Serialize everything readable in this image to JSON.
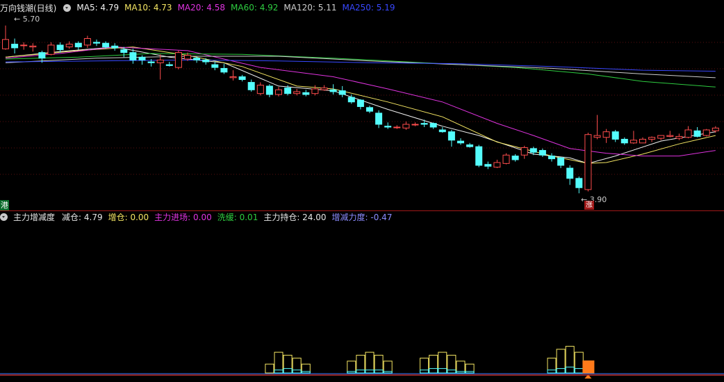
{
  "main_panel": {
    "title": "万向钱潮(日线)",
    "indicators": [
      {
        "label": "MA5: 4.79",
        "color": "#f2f2f2"
      },
      {
        "label": "MA10: 4.73",
        "color": "#f5e663"
      },
      {
        "label": "MA20: 4.58",
        "color": "#e033e0"
      },
      {
        "label": "MA60: 4.92",
        "color": "#2ecc40"
      },
      {
        "label": "MA120: 5.11",
        "color": "#cfcfcf"
      },
      {
        "label": "MA250: 5.19",
        "color": "#3848ff"
      }
    ],
    "high_label": "5.70",
    "low_label": "3.90",
    "mark_left": "港",
    "mark_low": "涨"
  },
  "sub_panel": {
    "title": "主力增减度",
    "indicators": [
      {
        "label": "减仓: 4.79",
        "color": "#e6e6e6"
      },
      {
        "label": "增仓: 0.00",
        "color": "#f5e663"
      },
      {
        "label": "主力进场: 0.00",
        "color": "#e033e0"
      },
      {
        "label": "洗缓: 0.01",
        "color": "#2ecc40"
      },
      {
        "label": "主力持仓: 24.00",
        "color": "#e6e6e6"
      },
      {
        "label": "增减力度: -0.47",
        "color": "#8c8cff"
      }
    ]
  },
  "chart_data": {
    "type": "candlestick",
    "ylim": [
      3.85,
      5.75
    ],
    "up_color": "#ff4d4d",
    "down_color": "#54fcfc",
    "candles": [
      [
        5.45,
        5.55,
        5.7,
        5.44
      ],
      [
        5.5,
        5.46,
        5.56,
        5.4
      ],
      [
        5.49,
        5.49,
        5.52,
        5.44
      ],
      [
        5.47,
        5.48,
        5.51,
        5.42
      ],
      [
        5.41,
        5.35,
        5.43,
        5.3
      ],
      [
        5.39,
        5.49,
        5.52,
        5.38
      ],
      [
        5.49,
        5.44,
        5.52,
        5.41
      ],
      [
        5.47,
        5.5,
        5.53,
        5.45
      ],
      [
        5.51,
        5.47,
        5.53,
        5.44
      ],
      [
        5.49,
        5.56,
        5.59,
        5.46
      ],
      [
        5.52,
        5.51,
        5.55,
        5.48
      ],
      [
        5.51,
        5.47,
        5.53,
        5.45
      ],
      [
        5.48,
        5.46,
        5.51,
        5.43
      ],
      [
        5.44,
        5.41,
        5.47,
        5.36
      ],
      [
        5.41,
        5.33,
        5.45,
        5.29
      ],
      [
        5.36,
        5.33,
        5.38,
        5.28
      ],
      [
        5.31,
        5.3,
        5.34,
        5.26
      ],
      [
        5.3,
        5.33,
        5.39,
        5.12
      ],
      [
        5.28,
        5.27,
        5.31,
        5.26
      ],
      [
        5.25,
        5.41,
        5.43,
        5.23
      ],
      [
        5.34,
        5.38,
        5.41,
        5.32
      ],
      [
        5.35,
        5.33,
        5.37,
        5.3
      ],
      [
        5.33,
        5.31,
        5.35,
        5.28
      ],
      [
        5.28,
        5.25,
        5.31,
        5.22
      ],
      [
        5.24,
        5.2,
        5.29,
        5.18
      ],
      [
        5.14,
        5.15,
        5.22,
        5.11
      ],
      [
        5.15,
        5.12,
        5.17,
        5.1
      ],
      [
        5.09,
        5.01,
        5.12,
        4.99
      ],
      [
        4.97,
        5.06,
        5.09,
        4.95
      ],
      [
        5.05,
        4.96,
        5.07,
        4.93
      ],
      [
        4.96,
        5.01,
        5.04,
        4.94
      ],
      [
        5.03,
        4.97,
        5.06,
        4.95
      ],
      [
        4.97,
        4.99,
        5.02,
        4.95
      ],
      [
        4.98,
        4.96,
        5.01,
        4.94
      ],
      [
        4.97,
        5.02,
        5.06,
        4.95
      ],
      [
        5.01,
        5.03,
        5.06,
        5.0
      ],
      [
        5.01,
        4.99,
        5.07,
        4.96
      ],
      [
        5.0,
        4.96,
        5.05,
        4.93
      ],
      [
        4.93,
        4.88,
        4.96,
        4.86
      ],
      [
        4.9,
        4.83,
        4.91,
        4.8
      ],
      [
        4.82,
        4.78,
        4.84,
        4.76
      ],
      [
        4.76,
        4.64,
        4.79,
        4.6
      ],
      [
        4.62,
        4.61,
        4.66,
        4.59
      ],
      [
        4.61,
        4.61,
        4.63,
        4.59
      ],
      [
        4.6,
        4.64,
        4.67,
        4.58
      ],
      [
        4.64,
        4.64,
        4.66,
        4.62
      ],
      [
        4.65,
        4.64,
        4.69,
        4.61
      ],
      [
        4.65,
        4.61,
        4.66,
        4.59
      ],
      [
        4.58,
        4.56,
        4.61,
        4.55
      ],
      [
        4.56,
        4.47,
        4.58,
        4.4
      ],
      [
        4.46,
        4.44,
        4.49,
        4.42
      ],
      [
        4.42,
        4.4,
        4.44,
        4.39
      ],
      [
        4.4,
        4.2,
        4.42,
        4.18
      ],
      [
        4.21,
        4.19,
        4.24,
        4.16
      ],
      [
        4.18,
        4.23,
        4.26,
        4.17
      ],
      [
        4.22,
        4.31,
        4.33,
        4.21
      ],
      [
        4.3,
        4.26,
        4.32,
        4.24
      ],
      [
        4.31,
        4.39,
        4.41,
        4.27
      ],
      [
        4.38,
        4.34,
        4.4,
        4.31
      ],
      [
        4.36,
        4.31,
        4.38,
        4.29
      ],
      [
        4.3,
        4.27,
        4.33,
        4.24
      ],
      [
        4.28,
        4.2,
        4.29,
        4.17
      ],
      [
        4.17,
        4.06,
        4.2,
        3.99
      ],
      [
        4.06,
        3.96,
        4.08,
        3.9
      ],
      [
        3.94,
        4.53,
        4.55,
        3.92
      ],
      [
        4.5,
        4.52,
        4.74,
        4.48
      ],
      [
        4.5,
        4.56,
        4.59,
        4.44
      ],
      [
        4.56,
        4.48,
        4.58,
        4.45
      ],
      [
        4.48,
        4.44,
        4.5,
        4.42
      ],
      [
        4.44,
        4.47,
        4.57,
        4.43
      ],
      [
        4.44,
        4.48,
        4.5,
        4.44
      ],
      [
        4.48,
        4.5,
        4.51,
        4.45
      ],
      [
        4.49,
        4.52,
        4.52,
        4.47
      ],
      [
        4.51,
        4.52,
        4.57,
        4.5
      ],
      [
        4.49,
        4.51,
        4.54,
        4.47
      ],
      [
        4.5,
        4.58,
        4.62,
        4.49
      ],
      [
        4.57,
        4.51,
        4.61,
        4.5
      ],
      [
        4.52,
        4.58,
        4.59,
        4.51
      ],
      [
        4.57,
        4.6,
        4.62,
        4.55
      ]
    ],
    "ma_lines": [
      {
        "name": "MA5",
        "color": "#f2f2f2",
        "points": [
          [
            0,
            5.36
          ],
          [
            6,
            5.42
          ],
          [
            12,
            5.47
          ],
          [
            18,
            5.36
          ],
          [
            24,
            5.3
          ],
          [
            30,
            5.05
          ],
          [
            36,
            5.0
          ],
          [
            42,
            4.8
          ],
          [
            48,
            4.62
          ],
          [
            52,
            4.52
          ],
          [
            58,
            4.32
          ],
          [
            62,
            4.28
          ],
          [
            64,
            4.22
          ],
          [
            67,
            4.3
          ],
          [
            72,
            4.46
          ],
          [
            78,
            4.56
          ]
        ]
      },
      {
        "name": "MA10",
        "color": "#f5e663",
        "points": [
          [
            0,
            5.36
          ],
          [
            8,
            5.43
          ],
          [
            14,
            5.47
          ],
          [
            20,
            5.38
          ],
          [
            26,
            5.26
          ],
          [
            32,
            5.05
          ],
          [
            36,
            5.02
          ],
          [
            42,
            4.88
          ],
          [
            48,
            4.72
          ],
          [
            54,
            4.45
          ],
          [
            60,
            4.3
          ],
          [
            64,
            4.22
          ],
          [
            66,
            4.23
          ],
          [
            70,
            4.32
          ],
          [
            74,
            4.43
          ],
          [
            78,
            4.52
          ]
        ]
      },
      {
        "name": "MA20",
        "color": "#e033e0",
        "points": [
          [
            0,
            5.35
          ],
          [
            6,
            5.4
          ],
          [
            12,
            5.47
          ],
          [
            20,
            5.43
          ],
          [
            28,
            5.25
          ],
          [
            36,
            5.15
          ],
          [
            42,
            5.02
          ],
          [
            48,
            4.88
          ],
          [
            54,
            4.65
          ],
          [
            58,
            4.52
          ],
          [
            62,
            4.38
          ],
          [
            66,
            4.33
          ],
          [
            70,
            4.3
          ],
          [
            74,
            4.3
          ],
          [
            78,
            4.36
          ]
        ]
      },
      {
        "name": "MA60",
        "color": "#2ecc40",
        "points": [
          [
            0,
            5.34
          ],
          [
            8,
            5.36
          ],
          [
            16,
            5.4
          ],
          [
            26,
            5.39
          ],
          [
            36,
            5.35
          ],
          [
            46,
            5.3
          ],
          [
            56,
            5.25
          ],
          [
            64,
            5.18
          ],
          [
            70,
            5.1
          ],
          [
            78,
            5.04
          ]
        ]
      },
      {
        "name": "MA120",
        "color": "#cfcfcf",
        "points": [
          [
            0,
            5.3
          ],
          [
            10,
            5.35
          ],
          [
            20,
            5.37
          ],
          [
            30,
            5.37
          ],
          [
            40,
            5.32
          ],
          [
            50,
            5.28
          ],
          [
            60,
            5.24
          ],
          [
            70,
            5.18
          ],
          [
            78,
            5.14
          ]
        ]
      },
      {
        "name": "MA250",
        "color": "#3848ff",
        "points": [
          [
            0,
            5.31
          ],
          [
            10,
            5.32
          ],
          [
            20,
            5.33
          ],
          [
            30,
            5.32
          ],
          [
            40,
            5.3
          ],
          [
            50,
            5.29
          ],
          [
            60,
            5.26
          ],
          [
            70,
            5.22
          ],
          [
            78,
            5.21
          ]
        ]
      }
    ],
    "sub_series": {
      "zeng_cang": [
        0,
        0,
        0,
        0,
        0,
        0,
        0,
        0,
        0,
        0,
        0,
        0,
        0,
        0,
        0,
        0,
        0,
        0,
        0,
        0,
        0,
        0,
        0,
        0,
        0,
        0,
        0,
        0,
        0,
        3,
        7,
        6,
        5,
        3,
        0,
        0,
        0,
        0,
        4,
        6,
        7,
        6,
        4,
        0,
        0,
        0,
        5,
        6,
        7,
        6,
        4,
        3,
        0,
        0,
        0,
        0,
        0,
        0,
        0,
        0,
        5,
        8,
        9,
        7,
        0,
        0,
        0,
        0,
        0,
        0,
        0,
        0,
        0,
        0,
        0,
        0,
        0,
        0,
        0
      ],
      "xi_huan": [
        0,
        0,
        0,
        0,
        0,
        0,
        0,
        0,
        0,
        0,
        0,
        0,
        0,
        0,
        0,
        0,
        0,
        0,
        0,
        0,
        0,
        0,
        0,
        0,
        0,
        0,
        0,
        0,
        0,
        0,
        1,
        1.5,
        1,
        0.5,
        0,
        0,
        0,
        0,
        0.5,
        1,
        1,
        1,
        0.5,
        0,
        0,
        0,
        1,
        1.5,
        1.5,
        1,
        0.5,
        0.5,
        0,
        0,
        0,
        0,
        0,
        0,
        0,
        0,
        1,
        1.5,
        2,
        1.5,
        0.5,
        0,
        0,
        0,
        0,
        0,
        0,
        0,
        0,
        0,
        0,
        0,
        0,
        0,
        0
      ],
      "main_entry_index": 64,
      "ylim": [
        0,
        12
      ]
    }
  }
}
